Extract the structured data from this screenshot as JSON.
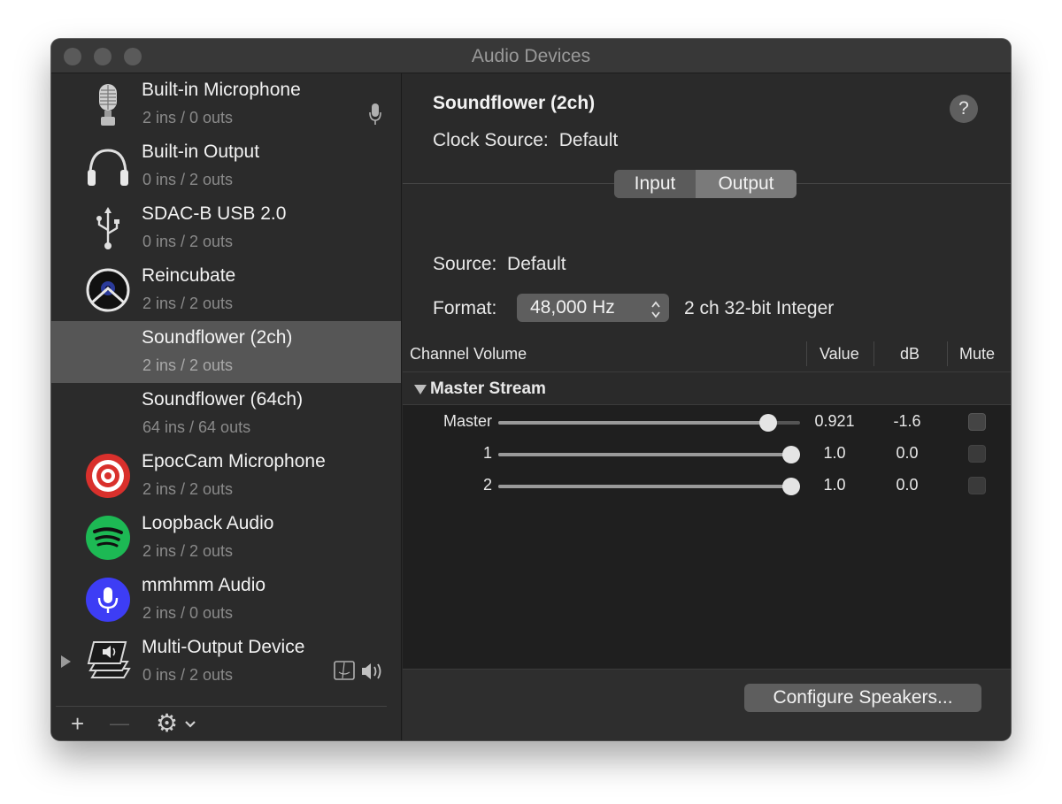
{
  "window": {
    "title": "Audio Devices"
  },
  "devices": [
    {
      "name": "Built-in Microphone",
      "io": "2 ins / 0 outs",
      "icon": "microphone-icon",
      "side_icon": "mic-small-icon"
    },
    {
      "name": "Built-in Output",
      "io": "0 ins / 2 outs",
      "icon": "headphones-icon"
    },
    {
      "name": "SDAC-B USB 2.0",
      "io": "0 ins / 2 outs",
      "icon": "usb-icon"
    },
    {
      "name": "Reincubate",
      "io": "2 ins / 2 outs",
      "icon": "reincubate-icon"
    },
    {
      "name": "Soundflower (2ch)",
      "io": "2 ins / 2 outs",
      "icon": "none",
      "selected": true
    },
    {
      "name": "Soundflower (64ch)",
      "io": "64 ins / 64 outs",
      "icon": "none"
    },
    {
      "name": "EpocCam Microphone",
      "io": "2 ins / 2 outs",
      "icon": "epoccam-icon"
    },
    {
      "name": "Loopback Audio",
      "io": "2 ins / 2 outs",
      "icon": "spotify-icon"
    },
    {
      "name": "mmhmm Audio",
      "io": "2 ins / 0 outs",
      "icon": "mmhmm-icon"
    },
    {
      "name": "Multi-Output Device",
      "io": "0 ins / 2 outs",
      "icon": "multi-output-icon",
      "side_icon": "finder-speaker-icon"
    }
  ],
  "sidebar_toolbar": {
    "add": "+",
    "remove": "—",
    "gear": "⚙"
  },
  "detail": {
    "title": "Soundflower (2ch)",
    "help": "?",
    "clock_label": "Clock Source:",
    "clock_value": "Default",
    "tabs": {
      "input": "Input",
      "output": "Output",
      "selected": "output"
    },
    "source_label": "Source:",
    "source_value": "Default",
    "format_label": "Format:",
    "format_value": "48,000 Hz",
    "format_desc": "2 ch 32-bit Integer"
  },
  "table": {
    "headers": {
      "channel": "Channel Volume",
      "value": "Value",
      "db": "dB",
      "mute": "Mute"
    },
    "group": "Master Stream",
    "rows": [
      {
        "label": "Master",
        "value": "0.921",
        "db": "-1.6",
        "level": 0.921,
        "muted": false
      },
      {
        "label": "1",
        "value": "1.0",
        "db": "0.0",
        "level": 1.0,
        "muted": false
      },
      {
        "label": "2",
        "value": "1.0",
        "db": "0.0",
        "level": 1.0,
        "muted": false
      }
    ]
  },
  "footer": {
    "configure_button": "Configure Speakers..."
  },
  "colors": {
    "window_bg": "#2a2a2a",
    "selected_row": "#565656",
    "epoccam_red": "#d9302c",
    "spotify_green": "#1db954",
    "mmhmm_blue": "#3d3df5"
  }
}
